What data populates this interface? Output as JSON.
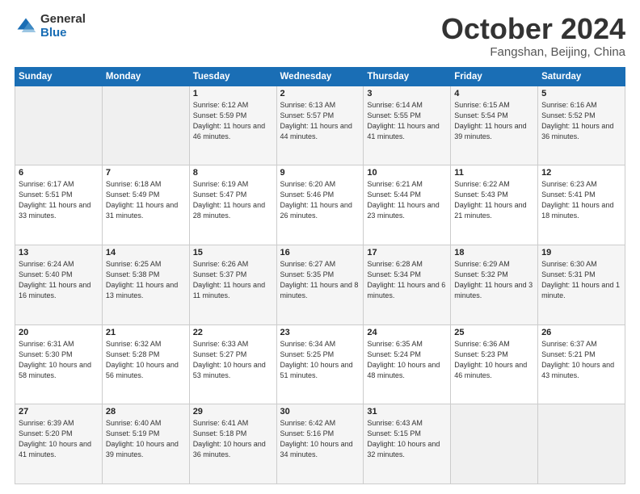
{
  "logo": {
    "general": "General",
    "blue": "Blue"
  },
  "header": {
    "month": "October 2024",
    "location": "Fangshan, Beijing, China"
  },
  "weekdays": [
    "Sunday",
    "Monday",
    "Tuesday",
    "Wednesday",
    "Thursday",
    "Friday",
    "Saturday"
  ],
  "weeks": [
    [
      {
        "day": "",
        "info": ""
      },
      {
        "day": "",
        "info": ""
      },
      {
        "day": "1",
        "info": "Sunrise: 6:12 AM\nSunset: 5:59 PM\nDaylight: 11 hours and 46 minutes."
      },
      {
        "day": "2",
        "info": "Sunrise: 6:13 AM\nSunset: 5:57 PM\nDaylight: 11 hours and 44 minutes."
      },
      {
        "day": "3",
        "info": "Sunrise: 6:14 AM\nSunset: 5:55 PM\nDaylight: 11 hours and 41 minutes."
      },
      {
        "day": "4",
        "info": "Sunrise: 6:15 AM\nSunset: 5:54 PM\nDaylight: 11 hours and 39 minutes."
      },
      {
        "day": "5",
        "info": "Sunrise: 6:16 AM\nSunset: 5:52 PM\nDaylight: 11 hours and 36 minutes."
      }
    ],
    [
      {
        "day": "6",
        "info": "Sunrise: 6:17 AM\nSunset: 5:51 PM\nDaylight: 11 hours and 33 minutes."
      },
      {
        "day": "7",
        "info": "Sunrise: 6:18 AM\nSunset: 5:49 PM\nDaylight: 11 hours and 31 minutes."
      },
      {
        "day": "8",
        "info": "Sunrise: 6:19 AM\nSunset: 5:47 PM\nDaylight: 11 hours and 28 minutes."
      },
      {
        "day": "9",
        "info": "Sunrise: 6:20 AM\nSunset: 5:46 PM\nDaylight: 11 hours and 26 minutes."
      },
      {
        "day": "10",
        "info": "Sunrise: 6:21 AM\nSunset: 5:44 PM\nDaylight: 11 hours and 23 minutes."
      },
      {
        "day": "11",
        "info": "Sunrise: 6:22 AM\nSunset: 5:43 PM\nDaylight: 11 hours and 21 minutes."
      },
      {
        "day": "12",
        "info": "Sunrise: 6:23 AM\nSunset: 5:41 PM\nDaylight: 11 hours and 18 minutes."
      }
    ],
    [
      {
        "day": "13",
        "info": "Sunrise: 6:24 AM\nSunset: 5:40 PM\nDaylight: 11 hours and 16 minutes."
      },
      {
        "day": "14",
        "info": "Sunrise: 6:25 AM\nSunset: 5:38 PM\nDaylight: 11 hours and 13 minutes."
      },
      {
        "day": "15",
        "info": "Sunrise: 6:26 AM\nSunset: 5:37 PM\nDaylight: 11 hours and 11 minutes."
      },
      {
        "day": "16",
        "info": "Sunrise: 6:27 AM\nSunset: 5:35 PM\nDaylight: 11 hours and 8 minutes."
      },
      {
        "day": "17",
        "info": "Sunrise: 6:28 AM\nSunset: 5:34 PM\nDaylight: 11 hours and 6 minutes."
      },
      {
        "day": "18",
        "info": "Sunrise: 6:29 AM\nSunset: 5:32 PM\nDaylight: 11 hours and 3 minutes."
      },
      {
        "day": "19",
        "info": "Sunrise: 6:30 AM\nSunset: 5:31 PM\nDaylight: 11 hours and 1 minute."
      }
    ],
    [
      {
        "day": "20",
        "info": "Sunrise: 6:31 AM\nSunset: 5:30 PM\nDaylight: 10 hours and 58 minutes."
      },
      {
        "day": "21",
        "info": "Sunrise: 6:32 AM\nSunset: 5:28 PM\nDaylight: 10 hours and 56 minutes."
      },
      {
        "day": "22",
        "info": "Sunrise: 6:33 AM\nSunset: 5:27 PM\nDaylight: 10 hours and 53 minutes."
      },
      {
        "day": "23",
        "info": "Sunrise: 6:34 AM\nSunset: 5:25 PM\nDaylight: 10 hours and 51 minutes."
      },
      {
        "day": "24",
        "info": "Sunrise: 6:35 AM\nSunset: 5:24 PM\nDaylight: 10 hours and 48 minutes."
      },
      {
        "day": "25",
        "info": "Sunrise: 6:36 AM\nSunset: 5:23 PM\nDaylight: 10 hours and 46 minutes."
      },
      {
        "day": "26",
        "info": "Sunrise: 6:37 AM\nSunset: 5:21 PM\nDaylight: 10 hours and 43 minutes."
      }
    ],
    [
      {
        "day": "27",
        "info": "Sunrise: 6:39 AM\nSunset: 5:20 PM\nDaylight: 10 hours and 41 minutes."
      },
      {
        "day": "28",
        "info": "Sunrise: 6:40 AM\nSunset: 5:19 PM\nDaylight: 10 hours and 39 minutes."
      },
      {
        "day": "29",
        "info": "Sunrise: 6:41 AM\nSunset: 5:18 PM\nDaylight: 10 hours and 36 minutes."
      },
      {
        "day": "30",
        "info": "Sunrise: 6:42 AM\nSunset: 5:16 PM\nDaylight: 10 hours and 34 minutes."
      },
      {
        "day": "31",
        "info": "Sunrise: 6:43 AM\nSunset: 5:15 PM\nDaylight: 10 hours and 32 minutes."
      },
      {
        "day": "",
        "info": ""
      },
      {
        "day": "",
        "info": ""
      }
    ]
  ]
}
